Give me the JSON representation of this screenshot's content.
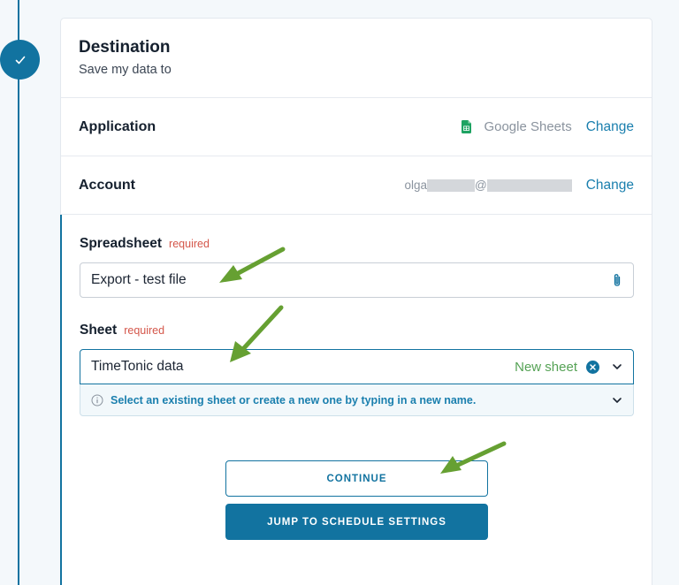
{
  "colors": {
    "primary": "#1273a0",
    "link": "#1a7fae",
    "required": "#d4564a",
    "new_sheet": "#55a255",
    "arrow": "#66a032"
  },
  "step": {
    "icon": "check-icon"
  },
  "header": {
    "title": "Destination",
    "subtitle": "Save my data to"
  },
  "application": {
    "label": "Application",
    "value": "Google Sheets",
    "icon": "google-sheets-icon",
    "change_label": "Change"
  },
  "account": {
    "label": "Account",
    "email_prefix": "olga",
    "email_at": "@",
    "change_label": "Change"
  },
  "spreadsheet": {
    "label": "Spreadsheet",
    "required_label": "required",
    "value": "Export - test file",
    "icon": "paperclip-icon"
  },
  "sheet": {
    "label": "Sheet",
    "required_label": "required",
    "value": "TimeTonic data",
    "tag": "New sheet",
    "hint": "Select an existing sheet or create a new one by typing in a new name."
  },
  "buttons": {
    "continue_label": "CONTINUE",
    "jump_label": "JUMP TO SCHEDULE SETTINGS"
  }
}
